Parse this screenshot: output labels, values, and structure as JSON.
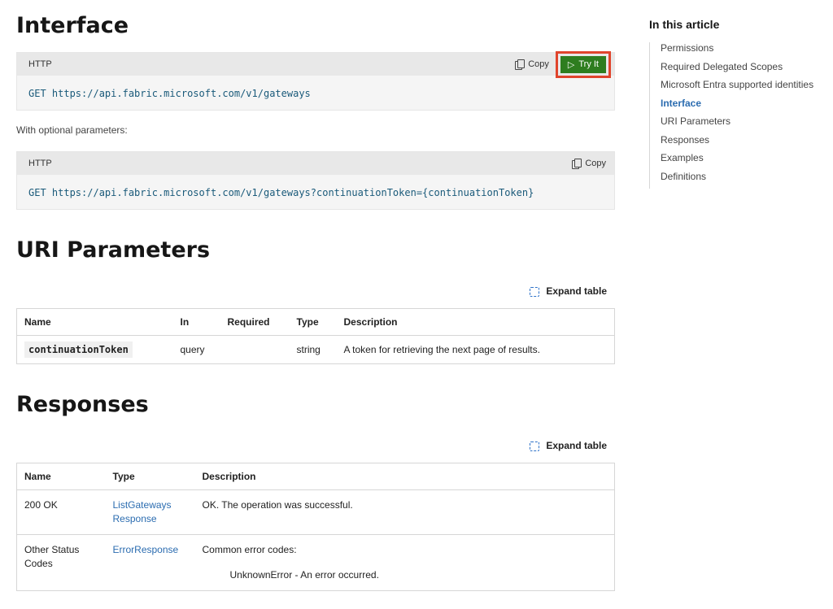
{
  "headings": {
    "interface": "Interface",
    "uri_parameters": "URI Parameters",
    "responses": "Responses"
  },
  "code1": {
    "lang": "HTTP",
    "copy": "Copy",
    "try_it": "Try It",
    "code": "GET https://api.fabric.microsoft.com/v1/gateways"
  },
  "optional_text": "With optional parameters:",
  "code2": {
    "lang": "HTTP",
    "copy": "Copy",
    "code": "GET https://api.fabric.microsoft.com/v1/gateways?continuationToken={continuationToken}"
  },
  "expand_table": "Expand table",
  "uri_table": {
    "headers": [
      "Name",
      "In",
      "Required",
      "Type",
      "Description"
    ],
    "rows": [
      [
        "continuationToken",
        "query",
        "",
        "string",
        "A token for retrieving the next page of results."
      ]
    ]
  },
  "resp_table": {
    "headers": [
      "Name",
      "Type",
      "Description"
    ],
    "rows": [
      {
        "name": "200 OK",
        "type": "ListGateways Response",
        "description": "OK. The operation was successful."
      },
      {
        "name": "Other Status Codes",
        "type": "ErrorResponse",
        "description": "Common error codes:",
        "detail": "UnknownError - An error occurred."
      }
    ]
  },
  "toc": {
    "title": "In this article",
    "items": [
      "Permissions",
      "Required Delegated Scopes",
      "Microsoft Entra supported identities",
      "Interface",
      "URI Parameters",
      "Responses",
      "Examples",
      "Definitions"
    ],
    "active": "Interface"
  },
  "colors": {
    "accent": "#2b6cb0",
    "try_it_bg": "#2e7d1f",
    "highlight": "#e0442c"
  }
}
